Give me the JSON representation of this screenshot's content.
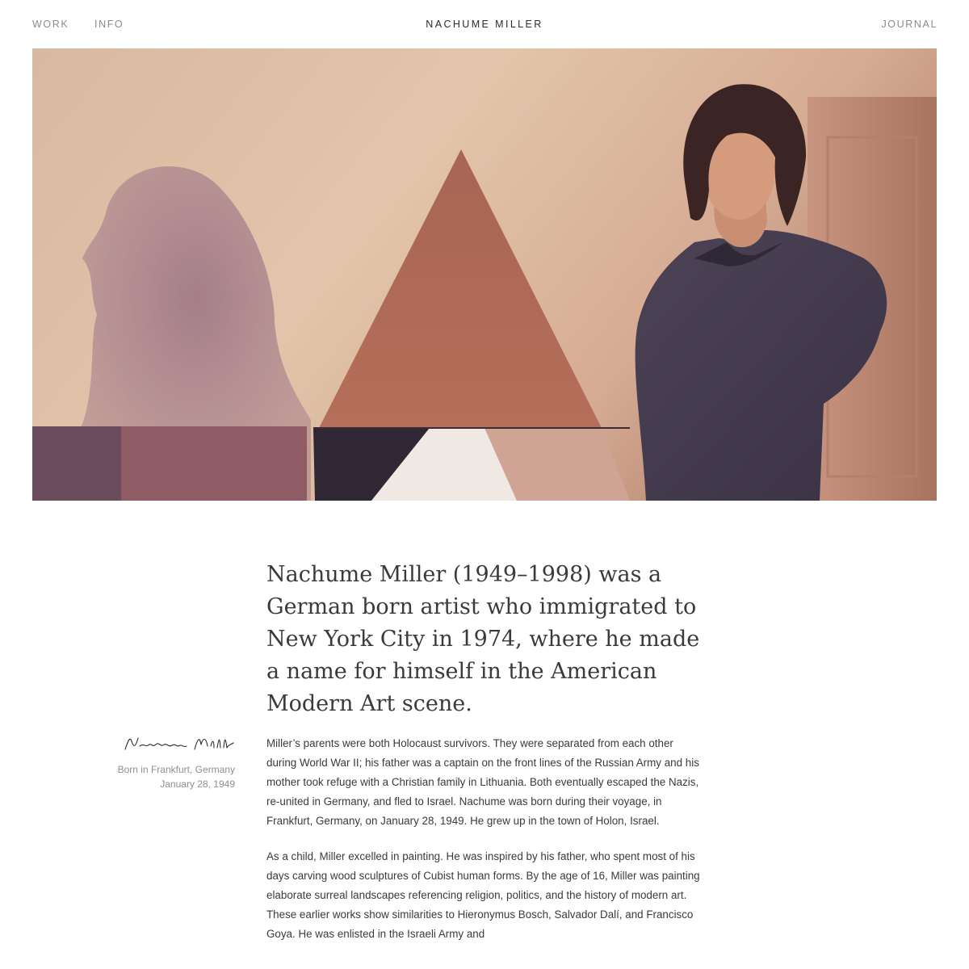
{
  "nav": {
    "work": "WORK",
    "info": "INFO",
    "title": "NACHUME MILLER",
    "journal": "JOURNAL"
  },
  "hero": {
    "image_icon": "photo-artist-with-triangle-painting"
  },
  "lead": "Nachume Miller (1949–1998) was a German born artist who immigrated to New York City in 1974, where he made a name for himself in the American Modern Art scene.",
  "sidebar": {
    "signature": "Nachume Miller",
    "born_place": "Born in Frankfurt, Germany",
    "born_date": "January 28, 1949"
  },
  "body": {
    "p1": "Miller’s parents were both Holocaust survivors. They were separated from each other during World War II; his father was a captain on the front lines of the Russian Army and his mother took refuge with a Christian family in Lithuania. Both eventually escaped the Nazis, re-united in Germany, and fled to Israel. Nachume was born during their voyage, in Frankfurt, Germany, on January 28, 1949. He grew up in the town of Holon, Israel.",
    "p2": "As a child, Miller excelled in painting. He was inspired by his father, who spent most of his days carving wood sculptures of Cubist human forms. By the age of 16, Miller was painting elaborate surreal landscapes referencing religion, politics, and the history of modern art. These earlier works show similarities to Hieronymus Bosch, Salvador Dalí, and Francisco Goya. He was enlisted in the Israeli Army and"
  },
  "colors": {
    "nav_text": "#8a8a8a",
    "title_text": "#2b2b2b",
    "body_text": "#3a3a3a",
    "muted_text": "#8e8e8e"
  }
}
